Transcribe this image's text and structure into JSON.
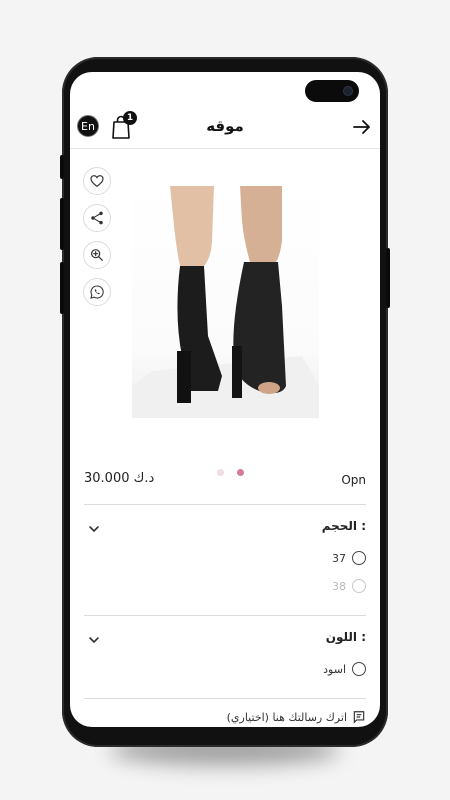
{
  "header": {
    "lang_label": "En",
    "cart_count": "1",
    "title": "موقه"
  },
  "product": {
    "price": "30.000 د.ك",
    "brand": "Opn"
  },
  "gallery": {
    "dot_active_color": "#d27b9a",
    "dot_inactive_color": "#f1dde4"
  },
  "options": [
    {
      "title": "الحجم :",
      "values": [
        {
          "label": "37",
          "disabled": false
        },
        {
          "label": "38",
          "disabled": true
        }
      ]
    },
    {
      "title": "اللون :",
      "values": [
        {
          "label": "اسود",
          "disabled": false
        }
      ]
    }
  ],
  "note": {
    "placeholder": "اترك رسالتك هنا (اختياري)"
  }
}
